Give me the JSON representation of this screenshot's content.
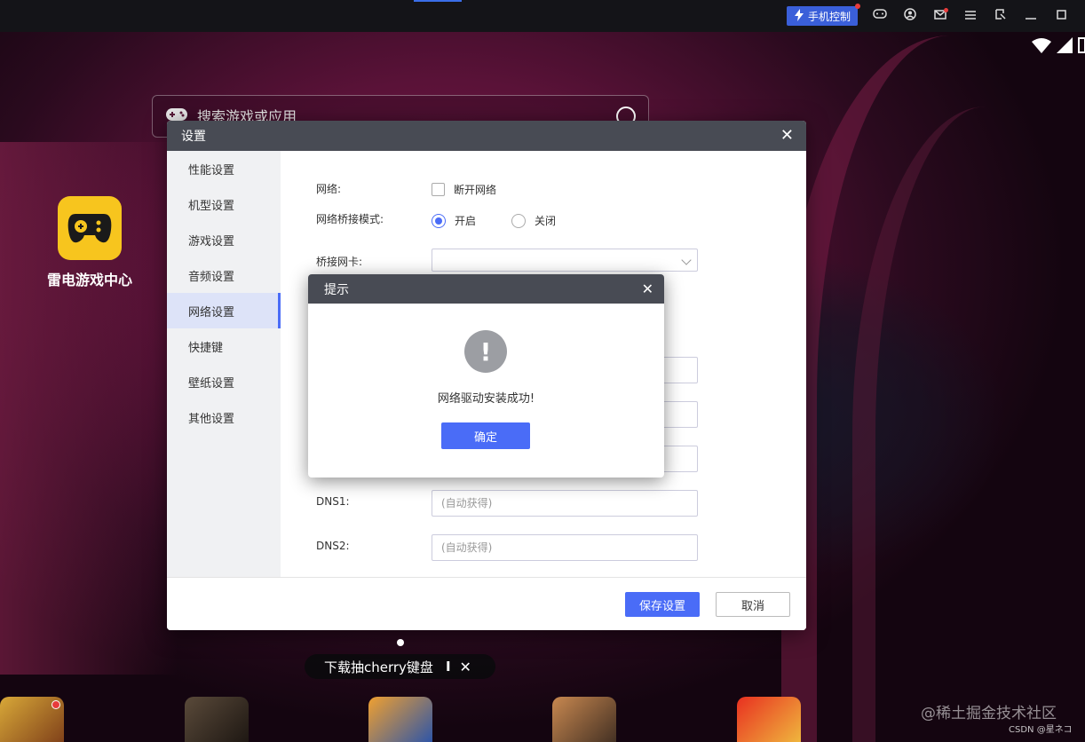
{
  "topbar": {
    "phone_control_label": "手机控制",
    "icons": [
      "lightning-icon",
      "gamepad-icon",
      "user-icon",
      "mail-icon",
      "menu-icon",
      "popout-icon",
      "minimize-icon",
      "maximize-icon"
    ]
  },
  "search": {
    "placeholder": "搜索游戏或应用"
  },
  "desktop": {
    "app_label": "雷电游戏中心"
  },
  "settings": {
    "title": "设置",
    "sidebar": [
      {
        "label": "性能设置"
      },
      {
        "label": "机型设置"
      },
      {
        "label": "游戏设置"
      },
      {
        "label": "音频设置"
      },
      {
        "label": "网络设置"
      },
      {
        "label": "快捷键"
      },
      {
        "label": "壁纸设置"
      },
      {
        "label": "其他设置"
      }
    ],
    "active_index": 4,
    "network_label": "网络:",
    "disconnect_label": "断开网络",
    "bridge_mode_label": "网络桥接模式:",
    "bridge_on_label": "开启",
    "bridge_off_label": "关闭",
    "bridge_nic_label": "桥接网卡:",
    "dns1_label": "DNS1:",
    "dns1_placeholder": "(自动获得)",
    "dns2_label": "DNS2:",
    "dns2_placeholder": "(自动获得)",
    "save_label": "保存设置",
    "cancel_label": "取消"
  },
  "prompt": {
    "title": "提示",
    "message": "网络驱动安装成功!",
    "ok_label": "确定"
  },
  "banner": {
    "text": "下载抽cherry键盘",
    "separator": "I"
  },
  "watermark": {
    "line1": "@稀土掘金技术社区",
    "line2": "CSDN @星ネコ"
  },
  "colors": {
    "accent": "#4a6cf7",
    "header": "#484b54",
    "app_icon": "#f7c51e"
  }
}
